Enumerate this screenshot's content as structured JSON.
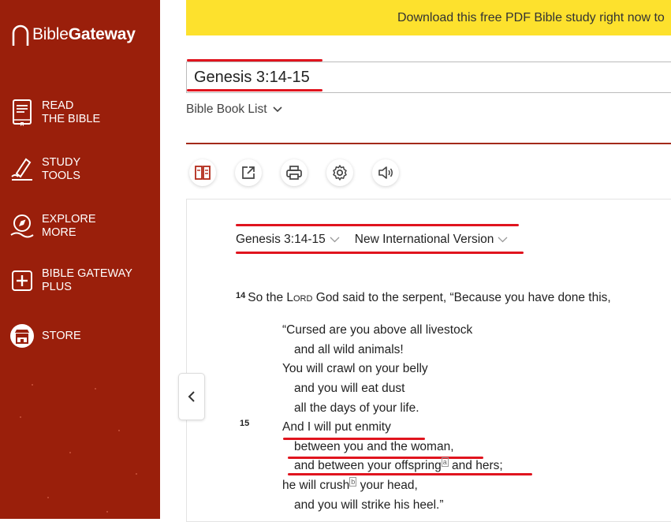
{
  "sidebar": {
    "logo_light": "Bible",
    "logo_bold": "Gateway",
    "items": [
      {
        "line1": "READ",
        "line2": "THE BIBLE",
        "icon": "book-icon"
      },
      {
        "line1": "STUDY",
        "line2": "TOOLS",
        "icon": "pen-icon"
      },
      {
        "line1": "EXPLORE",
        "line2": "MORE",
        "icon": "compass-icon"
      },
      {
        "line1": "BIBLE GATEWAY",
        "line2": "PLUS",
        "icon": "plus-box-icon"
      },
      {
        "line1": "STORE",
        "line2": "",
        "icon": "store-icon"
      }
    ]
  },
  "banner": {
    "text": "Download this free PDF Bible study right now to"
  },
  "search": {
    "value": "Genesis 3:14-15"
  },
  "booklist": {
    "label": "Bible Book List"
  },
  "toolbar": {
    "icons": [
      "parallel-icon",
      "share-icon",
      "print-icon",
      "settings-icon",
      "audio-icon"
    ]
  },
  "passage": {
    "reference": "Genesis 3:14-15",
    "version": "New International Version",
    "verse14": {
      "num": "14",
      "pre": "So the ",
      "lord": "Lord",
      "post": " God said to the serpent, “Because you have done this,"
    },
    "poetry": [
      "“Cursed are you above all livestock",
      "and all wild animals!",
      "You will crawl on your belly",
      "and you will eat dust",
      "all the days of your life."
    ],
    "verse15": {
      "num": "15",
      "line1": "And I will put enmity",
      "line2": "between you and the woman,",
      "line3_pre": "and between your offspring",
      "line3_fn": "a",
      "line3_post": " and hers;",
      "line4_pre": "he will crush",
      "line4_fn": "b",
      "line4_post": " your head,",
      "line5": "and you will strike his heel.”"
    }
  },
  "colors": {
    "sidebar": "#9a1f0b",
    "banner": "#fde12d",
    "annotation": "#e0141e"
  }
}
